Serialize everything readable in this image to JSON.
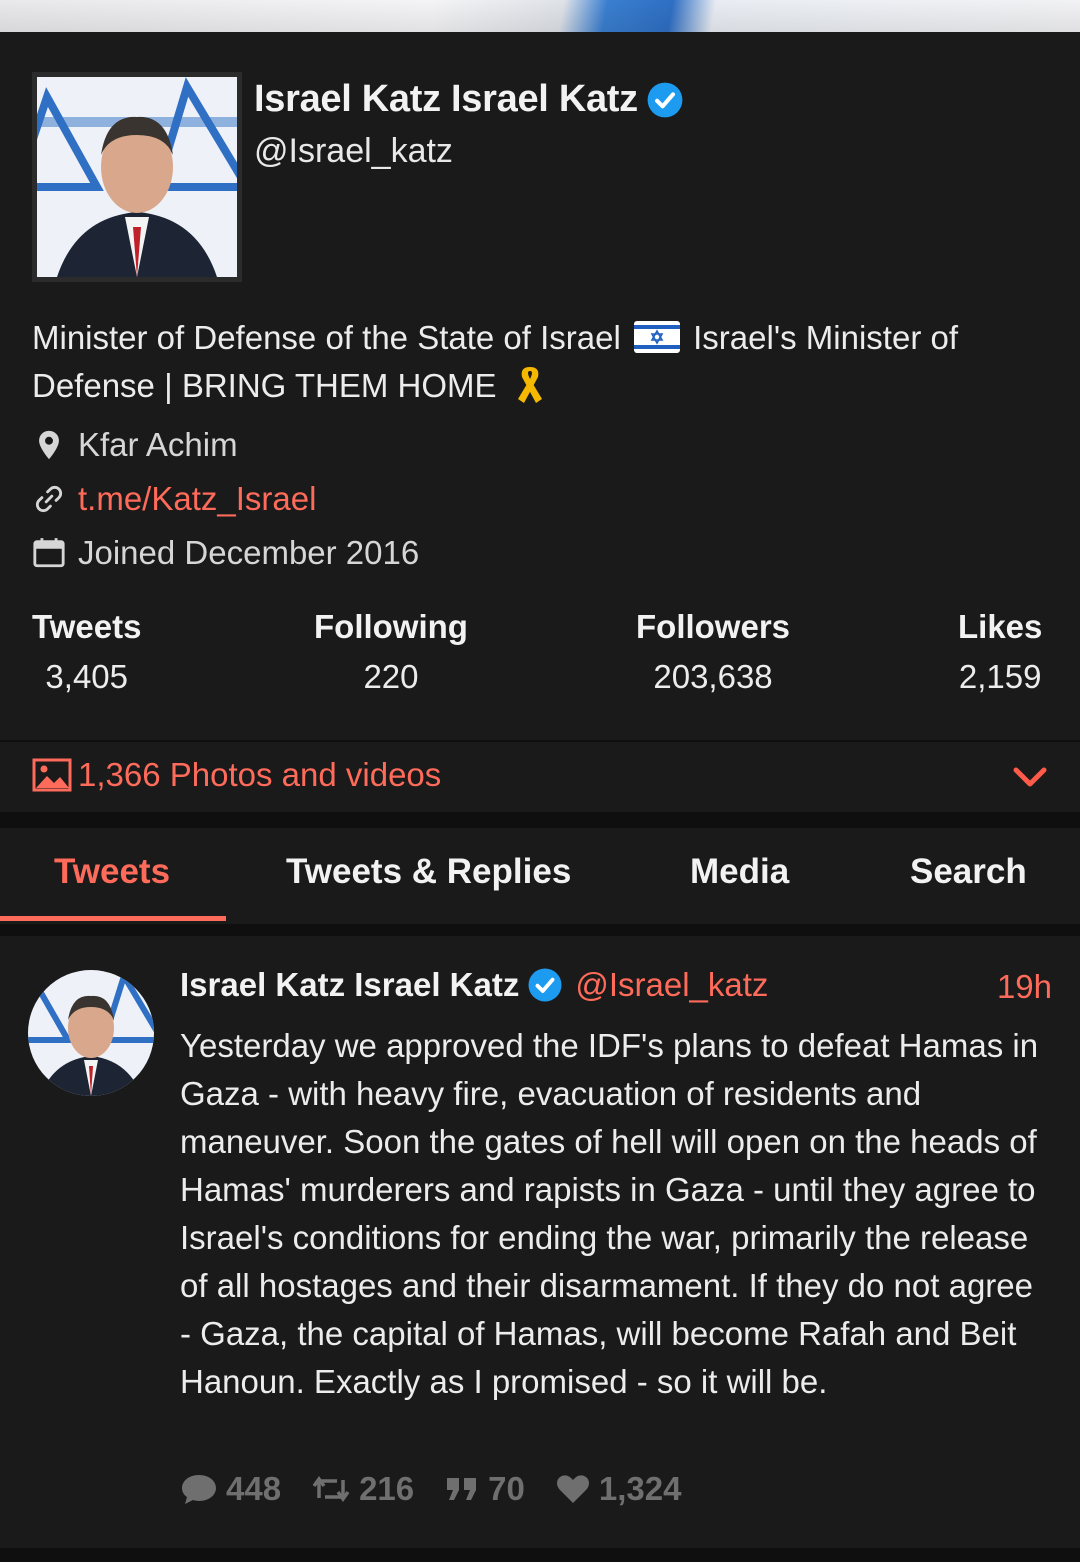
{
  "profile": {
    "display_name": "Israel Katz Israel Katz",
    "handle": "@Israel_katz",
    "bio_part1": "Minister of Defense of the State of Israel",
    "bio_part2": "Israel's Minister of Defense | BRING THEM HOME",
    "location": "Kfar Achim",
    "website": "t.me/Katz_Israel",
    "joined": "Joined December 2016"
  },
  "stats": [
    {
      "label": "Tweets",
      "value": "3,405"
    },
    {
      "label": "Following",
      "value": "220"
    },
    {
      "label": "Followers",
      "value": "203,638"
    },
    {
      "label": "Likes",
      "value": "2,159"
    }
  ],
  "media_bar": {
    "label": "1,366 Photos and videos"
  },
  "tabs": [
    {
      "label": "Tweets",
      "active": true
    },
    {
      "label": "Tweets & Replies",
      "active": false
    },
    {
      "label": "Media",
      "active": false
    },
    {
      "label": "Search",
      "active": false
    }
  ],
  "tweet": {
    "name": "Israel Katz Israel Katz",
    "handle": "@Israel_katz",
    "time": "19h",
    "text": "Yesterday we approved the IDF's plans to defeat Hamas in Gaza - with heavy fire, evacuation of residents and maneuver. Soon the gates of hell will open on the heads of Hamas' murderers and rapists in Gaza - until they agree to Israel's conditions for ending the war, primarily the release of all hostages and their disarmament. If they do not agree - Gaza, the capital of Hamas, will become Rafah and Beit Hanoun. Exactly as I promised - so it will be.",
    "replies": "448",
    "retweets": "216",
    "quotes": "70",
    "likes": "1,324"
  },
  "colors": {
    "accent": "#ff6b5a",
    "verified": "#1d9bf0",
    "background": "#1a1a1a"
  },
  "icons": [
    "verified-badge-icon",
    "israel-flag-icon",
    "yellow-ribbon-icon",
    "location-pin-icon",
    "link-icon",
    "calendar-icon",
    "image-icon",
    "chevron-down-icon",
    "comment-icon",
    "retweet-icon",
    "quote-icon",
    "heart-icon"
  ]
}
